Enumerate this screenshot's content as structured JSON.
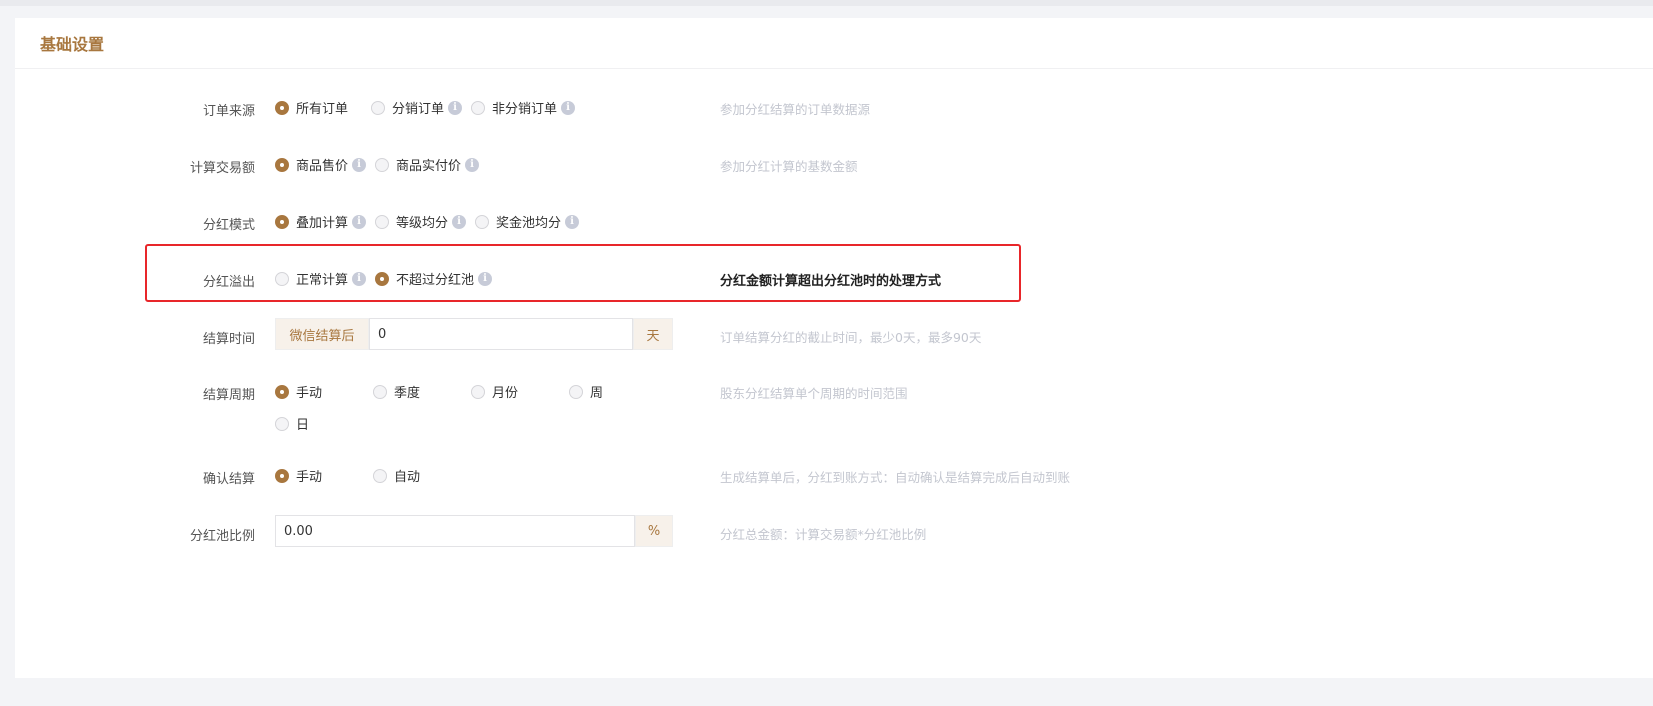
{
  "card": {
    "title": "基础设置"
  },
  "rows": {
    "order_source": {
      "label": "订单来源",
      "options": [
        "所有订单",
        "分销订单",
        "非分销订单"
      ],
      "hint": "参加分红结算的订单数据源"
    },
    "trade_amount": {
      "label": "计算交易额",
      "options": [
        "商品售价",
        "商品实付价"
      ],
      "hint": "参加分红计算的基数金额"
    },
    "dividend_mode": {
      "label": "分红模式",
      "options": [
        "叠加计算",
        "等级均分",
        "奖金池均分"
      ]
    },
    "dividend_overflow": {
      "label": "分红溢出",
      "options": [
        "正常计算",
        "不超过分红池"
      ],
      "hint": "分红金额计算超出分红池时的处理方式"
    },
    "settle_time": {
      "label": "结算时间",
      "prefix": "微信结算后",
      "value": "0",
      "suffix": "天",
      "hint": "订单结算分红的截止时间，最少0天，最多90天"
    },
    "settle_cycle": {
      "label": "结算周期",
      "options": [
        "手动",
        "季度",
        "月份",
        "周",
        "日"
      ],
      "hint": "股东分红结算单个周期的时间范围"
    },
    "confirm_settle": {
      "label": "确认结算",
      "options": [
        "手动",
        "自动"
      ],
      "hint": "生成结算单后，分红到账方式：自动确认是结算完成后自动到账"
    },
    "pool_ratio": {
      "label": "分红池比例",
      "value": "0.00",
      "suffix": "%",
      "hint": "分红总金额：计算交易额*分红池比例"
    }
  },
  "icons": {
    "info": "info-icon"
  },
  "colors": {
    "accent": "#a8773f",
    "highlight": "#e8262a",
    "hint": "#c3c6cf"
  }
}
